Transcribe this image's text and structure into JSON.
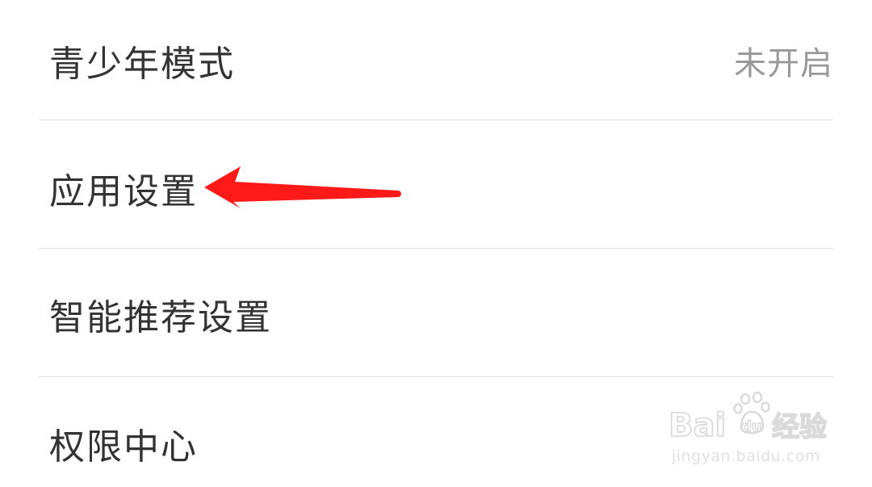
{
  "settings": {
    "items": [
      {
        "label": "青少年模式",
        "value": "未开启"
      },
      {
        "label": "应用设置"
      },
      {
        "label": "智能推荐设置"
      },
      {
        "label": "权限中心"
      }
    ]
  },
  "colors": {
    "label_text": "#333333",
    "value_text": "#999999",
    "divider": "#dedede",
    "annotation_arrow": "#ff1a1a"
  },
  "watermark": {
    "logo_text": "Baidu经验",
    "url": "jingyan.baidu.com"
  }
}
